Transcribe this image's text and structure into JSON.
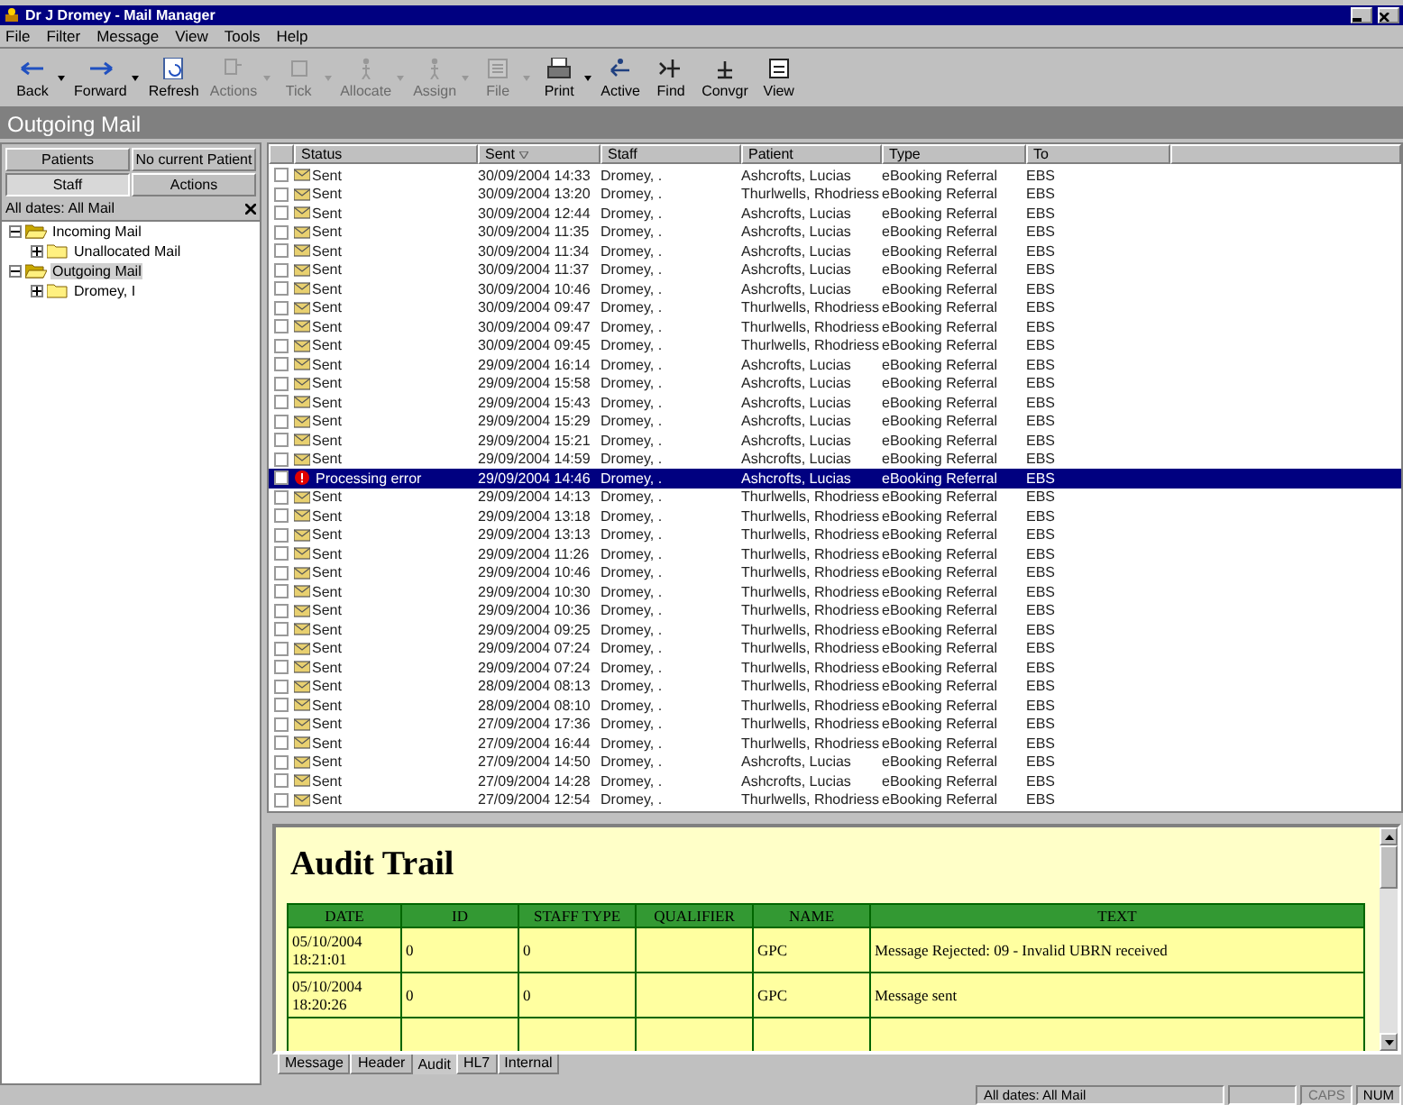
{
  "window": {
    "title": "Dr J Dromey - Mail Manager"
  },
  "menu": [
    "File",
    "Filter",
    "Message",
    "View",
    "Tools",
    "Help"
  ],
  "toolbar": [
    {
      "label": "Back",
      "disabled": false,
      "dropdown": true
    },
    {
      "label": "Forward",
      "disabled": false,
      "dropdown": true
    },
    {
      "label": "Refresh",
      "disabled": false,
      "dropdown": false
    },
    {
      "label": "Actions",
      "disabled": true,
      "dropdown": true
    },
    {
      "label": "Tick",
      "disabled": true,
      "dropdown": true
    },
    {
      "label": "Allocate",
      "disabled": true,
      "dropdown": true
    },
    {
      "label": "Assign",
      "disabled": true,
      "dropdown": true
    },
    {
      "label": "File",
      "disabled": true,
      "dropdown": true
    },
    {
      "label": "Print",
      "disabled": false,
      "dropdown": true
    },
    {
      "label": "Active",
      "disabled": false,
      "dropdown": false
    },
    {
      "label": "Find",
      "disabled": false,
      "dropdown": false
    },
    {
      "label": "Convgr",
      "disabled": false,
      "dropdown": false
    },
    {
      "label": "View",
      "disabled": false,
      "dropdown": false
    }
  ],
  "page_title": "Outgoing Mail",
  "sidebar": {
    "tabs": [
      {
        "label": "Patients",
        "selected": false
      },
      {
        "label": "Staff",
        "selected": true
      },
      {
        "label": "Actions",
        "selected": false
      }
    ],
    "patient": "No current Patient",
    "filter": "All dates: All Mail",
    "tree": [
      {
        "label": "Incoming Mail",
        "expanded": true,
        "selected": false,
        "children": [
          {
            "label": "Unallocated Mail",
            "expanded": false,
            "selected": false
          }
        ]
      },
      {
        "label": "Outgoing Mail",
        "expanded": true,
        "selected": true,
        "children": [
          {
            "label": "Dromey, I",
            "expanded": false,
            "selected": false
          }
        ]
      }
    ]
  },
  "table": {
    "columns": [
      "Status",
      "Sent",
      "Staff",
      "Patient",
      "Type",
      "To"
    ],
    "rows": [
      {
        "checked": false,
        "kind": "sent",
        "status": "Sent",
        "sent": "30/09/2004 14:33",
        "staff": "Dromey, .",
        "patient": "Ashcrofts, Lucias",
        "type": "eBooking Referral",
        "to": "EBS",
        "selected": false
      },
      {
        "checked": false,
        "kind": "sent",
        "status": "Sent",
        "sent": "30/09/2004 13:20",
        "staff": "Dromey, .",
        "patient": "Thurlwells, Rhodriess",
        "type": "eBooking Referral",
        "to": "EBS",
        "selected": false
      },
      {
        "checked": false,
        "kind": "sent",
        "status": "Sent",
        "sent": "30/09/2004 12:44",
        "staff": "Dromey, .",
        "patient": "Ashcrofts, Lucias",
        "type": "eBooking Referral",
        "to": "EBS",
        "selected": false
      },
      {
        "checked": false,
        "kind": "sent",
        "status": "Sent",
        "sent": "30/09/2004 11:35",
        "staff": "Dromey, .",
        "patient": "Ashcrofts, Lucias",
        "type": "eBooking Referral",
        "to": "EBS",
        "selected": false
      },
      {
        "checked": false,
        "kind": "sent",
        "status": "Sent",
        "sent": "30/09/2004 11:34",
        "staff": "Dromey, .",
        "patient": "Ashcrofts, Lucias",
        "type": "eBooking Referral",
        "to": "EBS",
        "selected": false
      },
      {
        "checked": false,
        "kind": "sent",
        "status": "Sent",
        "sent": "30/09/2004 11:37",
        "staff": "Dromey, .",
        "patient": "Ashcrofts, Lucias",
        "type": "eBooking Referral",
        "to": "EBS",
        "selected": false
      },
      {
        "checked": false,
        "kind": "sent",
        "status": "Sent",
        "sent": "30/09/2004 10:46",
        "staff": "Dromey, .",
        "patient": "Ashcrofts, Lucias",
        "type": "eBooking Referral",
        "to": "EBS",
        "selected": false
      },
      {
        "checked": false,
        "kind": "sent",
        "status": "Sent",
        "sent": "30/09/2004 09:47",
        "staff": "Dromey, .",
        "patient": "Thurlwells, Rhodriess",
        "type": "eBooking Referral",
        "to": "EBS",
        "selected": false
      },
      {
        "checked": false,
        "kind": "sent",
        "status": "Sent",
        "sent": "30/09/2004 09:47",
        "staff": "Dromey, .",
        "patient": "Thurlwells, Rhodriess",
        "type": "eBooking Referral",
        "to": "EBS",
        "selected": false
      },
      {
        "checked": false,
        "kind": "sent",
        "status": "Sent",
        "sent": "30/09/2004 09:45",
        "staff": "Dromey, .",
        "patient": "Thurlwells, Rhodriess",
        "type": "eBooking Referral",
        "to": "EBS",
        "selected": false
      },
      {
        "checked": false,
        "kind": "sent",
        "status": "Sent",
        "sent": "29/09/2004 16:14",
        "staff": "Dromey, .",
        "patient": "Ashcrofts, Lucias",
        "type": "eBooking Referral",
        "to": "EBS",
        "selected": false
      },
      {
        "checked": false,
        "kind": "sent",
        "status": "Sent",
        "sent": "29/09/2004 15:58",
        "staff": "Dromey, .",
        "patient": "Ashcrofts, Lucias",
        "type": "eBooking Referral",
        "to": "EBS",
        "selected": false
      },
      {
        "checked": false,
        "kind": "sent",
        "status": "Sent",
        "sent": "29/09/2004 15:43",
        "staff": "Dromey, .",
        "patient": "Ashcrofts, Lucias",
        "type": "eBooking Referral",
        "to": "EBS",
        "selected": false
      },
      {
        "checked": false,
        "kind": "sent",
        "status": "Sent",
        "sent": "29/09/2004 15:29",
        "staff": "Dromey, .",
        "patient": "Ashcrofts, Lucias",
        "type": "eBooking Referral",
        "to": "EBS",
        "selected": false
      },
      {
        "checked": false,
        "kind": "sent",
        "status": "Sent",
        "sent": "29/09/2004 15:21",
        "staff": "Dromey, .",
        "patient": "Ashcrofts, Lucias",
        "type": "eBooking Referral",
        "to": "EBS",
        "selected": false
      },
      {
        "checked": false,
        "kind": "sent",
        "status": "Sent",
        "sent": "29/09/2004 14:59",
        "staff": "Dromey, .",
        "patient": "Ashcrofts, Lucias",
        "type": "eBooking Referral",
        "to": "EBS",
        "selected": false
      },
      {
        "checked": false,
        "kind": "error",
        "status": "Processing error",
        "sent": "29/09/2004 14:46",
        "staff": "Dromey, .",
        "patient": "Ashcrofts, Lucias",
        "type": "eBooking Referral",
        "to": "EBS",
        "selected": true
      },
      {
        "checked": false,
        "kind": "sent",
        "status": "Sent",
        "sent": "29/09/2004 14:13",
        "staff": "Dromey, .",
        "patient": "Thurlwells, Rhodriess",
        "type": "eBooking Referral",
        "to": "EBS",
        "selected": false
      },
      {
        "checked": false,
        "kind": "sent",
        "status": "Sent",
        "sent": "29/09/2004 13:18",
        "staff": "Dromey, .",
        "patient": "Thurlwells, Rhodriess",
        "type": "eBooking Referral",
        "to": "EBS",
        "selected": false
      },
      {
        "checked": false,
        "kind": "sent",
        "status": "Sent",
        "sent": "29/09/2004 13:13",
        "staff": "Dromey, .",
        "patient": "Thurlwells, Rhodriess",
        "type": "eBooking Referral",
        "to": "EBS",
        "selected": false
      },
      {
        "checked": false,
        "kind": "sent",
        "status": "Sent",
        "sent": "29/09/2004 11:26",
        "staff": "Dromey, .",
        "patient": "Thurlwells, Rhodriess",
        "type": "eBooking Referral",
        "to": "EBS",
        "selected": false
      },
      {
        "checked": false,
        "kind": "sent",
        "status": "Sent",
        "sent": "29/09/2004 10:46",
        "staff": "Dromey, .",
        "patient": "Thurlwells, Rhodriess",
        "type": "eBooking Referral",
        "to": "EBS",
        "selected": false
      },
      {
        "checked": false,
        "kind": "sent",
        "status": "Sent",
        "sent": "29/09/2004 10:30",
        "staff": "Dromey, .",
        "patient": "Thurlwells, Rhodriess",
        "type": "eBooking Referral",
        "to": "EBS",
        "selected": false
      },
      {
        "checked": false,
        "kind": "sent",
        "status": "Sent",
        "sent": "29/09/2004 10:36",
        "staff": "Dromey, .",
        "patient": "Thurlwells, Rhodriess",
        "type": "eBooking Referral",
        "to": "EBS",
        "selected": false
      },
      {
        "checked": false,
        "kind": "sent",
        "status": "Sent",
        "sent": "29/09/2004 09:25",
        "staff": "Dromey, .",
        "patient": "Thurlwells, Rhodriess",
        "type": "eBooking Referral",
        "to": "EBS",
        "selected": false
      },
      {
        "checked": false,
        "kind": "sent",
        "status": "Sent",
        "sent": "29/09/2004 07:24",
        "staff": "Dromey, .",
        "patient": "Thurlwells, Rhodriess",
        "type": "eBooking Referral",
        "to": "EBS",
        "selected": false
      },
      {
        "checked": false,
        "kind": "sent",
        "status": "Sent",
        "sent": "29/09/2004 07:24",
        "staff": "Dromey, .",
        "patient": "Thurlwells, Rhodriess",
        "type": "eBooking Referral",
        "to": "EBS",
        "selected": false
      },
      {
        "checked": false,
        "kind": "sent",
        "status": "Sent",
        "sent": "28/09/2004 08:13",
        "staff": "Dromey, .",
        "patient": "Thurlwells, Rhodriess",
        "type": "eBooking Referral",
        "to": "EBS",
        "selected": false
      },
      {
        "checked": false,
        "kind": "sent",
        "status": "Sent",
        "sent": "28/09/2004 08:10",
        "staff": "Dromey, .",
        "patient": "Thurlwells, Rhodriess",
        "type": "eBooking Referral",
        "to": "EBS",
        "selected": false
      },
      {
        "checked": false,
        "kind": "sent",
        "status": "Sent",
        "sent": "27/09/2004 17:36",
        "staff": "Dromey, .",
        "patient": "Thurlwells, Rhodriess",
        "type": "eBooking Referral",
        "to": "EBS",
        "selected": false
      },
      {
        "checked": false,
        "kind": "sent",
        "status": "Sent",
        "sent": "27/09/2004 16:44",
        "staff": "Dromey, .",
        "patient": "Thurlwells, Rhodriess",
        "type": "eBooking Referral",
        "to": "EBS",
        "selected": false
      },
      {
        "checked": false,
        "kind": "sent",
        "status": "Sent",
        "sent": "27/09/2004 14:50",
        "staff": "Dromey, .",
        "patient": "Ashcrofts, Lucias",
        "type": "eBooking Referral",
        "to": "EBS",
        "selected": false
      },
      {
        "checked": false,
        "kind": "sent",
        "status": "Sent",
        "sent": "27/09/2004 14:28",
        "staff": "Dromey, .",
        "patient": "Ashcrofts, Lucias",
        "type": "eBooking Referral",
        "to": "EBS",
        "selected": false
      },
      {
        "checked": false,
        "kind": "sent",
        "status": "Sent",
        "sent": "27/09/2004 12:54",
        "staff": "Dromey, .",
        "patient": "Thurlwells, Rhodriess",
        "type": "eBooking Referral",
        "to": "EBS",
        "selected": false
      }
    ]
  },
  "audit": {
    "title": "Audit Trail",
    "columns": [
      "DATE",
      "ID",
      "STAFF TYPE",
      "QUALIFIER",
      "NAME",
      "TEXT"
    ],
    "rows": [
      [
        "05/10/2004 18:21:01",
        "0",
        "0",
        "",
        "GPC",
        "Message Rejected: 09 - Invalid UBRN received"
      ],
      [
        "05/10/2004 18:20:26",
        "0",
        "0",
        "",
        "GPC",
        "Message sent"
      ]
    ]
  },
  "detail_tabs": [
    {
      "label": "Message",
      "selected": false
    },
    {
      "label": "Header",
      "selected": false
    },
    {
      "label": "Audit",
      "selected": true
    },
    {
      "label": "HL7",
      "selected": false
    },
    {
      "label": "Internal",
      "selected": false
    }
  ],
  "status_bar": {
    "filter": "All dates: All Mail",
    "caps": {
      "label": "CAPS",
      "on": false
    },
    "num": {
      "label": "NUM",
      "on": true
    }
  }
}
